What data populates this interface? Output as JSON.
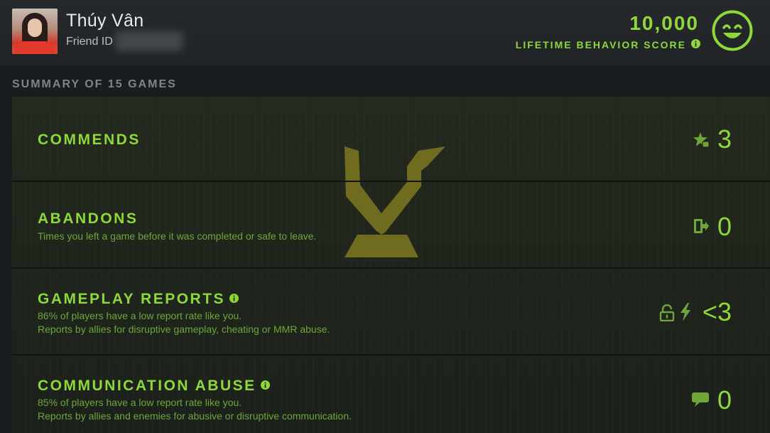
{
  "profile": {
    "name": "Thúy Vân",
    "friend_id_label": "Friend ID"
  },
  "behavior": {
    "score": "10,000",
    "label": "LIFETIME BEHAVIOR SCORE"
  },
  "summary": {
    "title": "SUMMARY OF 15 GAMES",
    "rows": [
      {
        "title": "COMMENDS",
        "lines": [],
        "value": "3",
        "icon": "star-thumb-icon"
      },
      {
        "title": "ABANDONS",
        "lines": [
          "Times you left a game before it was completed or safe to leave."
        ],
        "value": "0",
        "icon": "exit-door-icon"
      },
      {
        "title": "GAMEPLAY REPORTS",
        "lines": [
          "86% of players have a low report rate like you.",
          "Reports by allies for disruptive gameplay, cheating or MMR abuse."
        ],
        "value": "<3",
        "icon": "lock-lightning-icon"
      },
      {
        "title": "COMMUNICATION ABUSE",
        "lines": [
          "85% of players have a low report rate like you.",
          "Reports by allies and enemies for abusive or disruptive communication."
        ],
        "value": "0",
        "icon": "chat-bubble-icon"
      }
    ]
  },
  "colors": {
    "accent": "#8fd83a",
    "muted_text": "#7d8589",
    "header_bg": "#25292b",
    "emblem": "#8a8320"
  }
}
